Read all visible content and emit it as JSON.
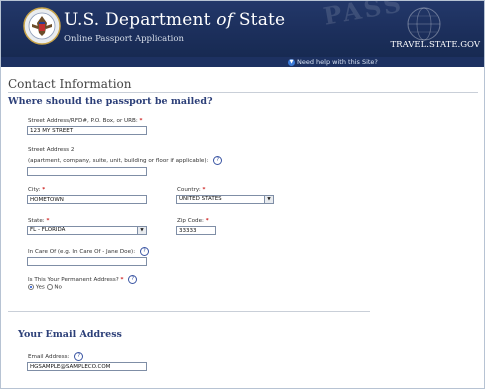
{
  "header": {
    "title_main": "U.S. Department",
    "title_of": "of",
    "title_state": "State",
    "subtitle": "Online Passport Application",
    "watermark": "PASS",
    "brand": "TRAVEL.STATE.GOV"
  },
  "helpbar": {
    "help_text": "Need help with this Site?",
    "help_icon": "info-icon"
  },
  "page": {
    "title": "Contact Information",
    "mail_heading": "Where should the passport be mailed?",
    "email_heading": "Your Email Address"
  },
  "form": {
    "street1_label": "Street Address/RFD#, P.O. Box, or URB:",
    "street1_value": "123 MY STREET",
    "street2_label": "Street Address 2",
    "street2_hint": "(apartment, company, suite, unit, building or floor if applicable):",
    "street2_value": "",
    "city_label": "City:",
    "city_value": "HOMETOWN",
    "country_label": "Country:",
    "country_value": "UNITED STATES",
    "state_label": "State:",
    "state_value": "FL - FLORIDA",
    "zip_label": "Zip Code:",
    "zip_value": "33333",
    "care_label": "In Care Of (e.g. In Care Of - Jane Doe):",
    "care_value": "",
    "permanent_label": "Is This Your Permanent Address?",
    "yes_label": "Yes",
    "no_label": "No",
    "permanent_selected": "Yes",
    "email_label": "Email Address:",
    "email_value": "HGSAMPLE@SAMPLECO.COM",
    "required_mark": "*",
    "help_mark": "?"
  },
  "colors": {
    "header_bg": "#1c2f5c",
    "heading_blue": "#2c3f78",
    "required_red": "#cc1f1f"
  }
}
